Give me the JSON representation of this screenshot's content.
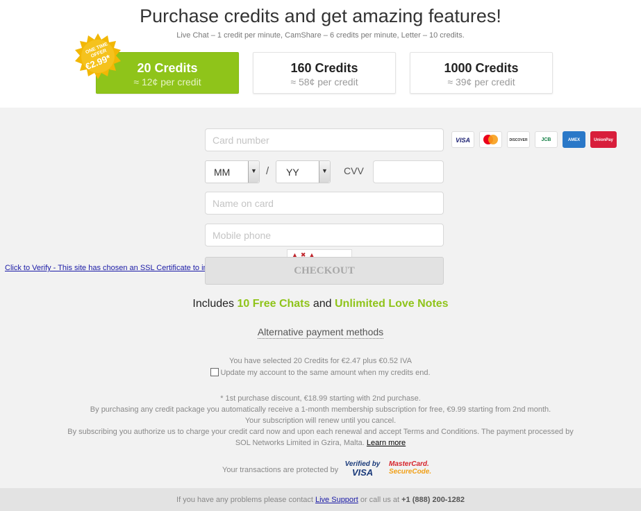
{
  "header": {
    "title": "Purchase credits and get amazing features!",
    "subtitle": "Live Chat – 1 credit per minute, CamShare – 6 credits per minute, Letter – 10 credits."
  },
  "badge": {
    "line1": "ONE TIME",
    "line2": "OFFER",
    "price": "€2.99*"
  },
  "packages": [
    {
      "name": "20 Credits",
      "price": "≈ 12¢ per credit",
      "selected": true
    },
    {
      "name": "160 Credits",
      "price": "≈ 58¢ per credit",
      "selected": false
    },
    {
      "name": "1000 Credits",
      "price": "≈ 39¢ per credit",
      "selected": false
    }
  ],
  "form": {
    "card_number_placeholder": "Card number",
    "month_value": "MM",
    "year_value": "YY",
    "slash": "/",
    "cvv_label": "CVV",
    "name_placeholder": "Name on card",
    "phone_placeholder": "Mobile phone",
    "checkout_label": "CHECKOUT"
  },
  "card_logos": [
    {
      "icon": "visa-icon",
      "label": "VISA",
      "bg": "#ffffff",
      "fg": "#1a1f71"
    },
    {
      "icon": "mastercard-icon",
      "label": "",
      "bg": "#ffffff",
      "fg": "#eb001b"
    },
    {
      "icon": "discover-icon",
      "label": "DISCOVER",
      "bg": "#ffffff",
      "fg": "#333333"
    },
    {
      "icon": "jcb-icon",
      "label": "JCB",
      "bg": "#ffffff",
      "fg": "#0b7a3e"
    },
    {
      "icon": "amex-icon",
      "label": "AMEX",
      "bg": "#2a78c8",
      "fg": "#ffffff"
    },
    {
      "icon": "unionpay-icon",
      "label": "UnionPay",
      "bg": "#d81e3b",
      "fg": "#ffffff"
    }
  ],
  "ssl": {
    "link_text": "Click to Verify - This site has chosen an SSL Certificate to improve Web site security"
  },
  "includes": {
    "prefix": "Includes ",
    "chats": "10 Free Chats",
    "and": " and ",
    "notes": "Unlimited Love Notes"
  },
  "alternative_label": "Alternative payment methods",
  "selection": {
    "text": "You have selected 20 Credits for €2.47 plus €0.52 IVA",
    "update_label": "Update my account to the same amount when my credits end."
  },
  "terms": {
    "line1": "* 1st purchase discount, €18.99 starting with 2nd purchase.",
    "line2": "By purchasing any credit package you automatically receive a 1-month membership subscription for free, €9.99 starting from 2nd month.",
    "line3": "Your subscription will renew until you cancel.",
    "line4": "By subscribing you authorize us to charge your credit card now and upon each renewal and accept Terms and Conditions. The payment processed by SOL Networks Limited in Gzira, Malta. ",
    "learn_more": "Learn more"
  },
  "protection": {
    "text": "Your transactions are protected by",
    "vbv_line1": "Verified by",
    "vbv_line2": "VISA",
    "msc_line1": "MasterCard.",
    "msc_line2": "SecureCode."
  },
  "footer": {
    "prefix": "If you have any problems please contact ",
    "link": "Live Support",
    "middle": " or call us at ",
    "phone": "+1 (888) 200-1282"
  },
  "colors": {
    "accent_green": "#8fc41a",
    "badge_gold": "#f2b705"
  }
}
